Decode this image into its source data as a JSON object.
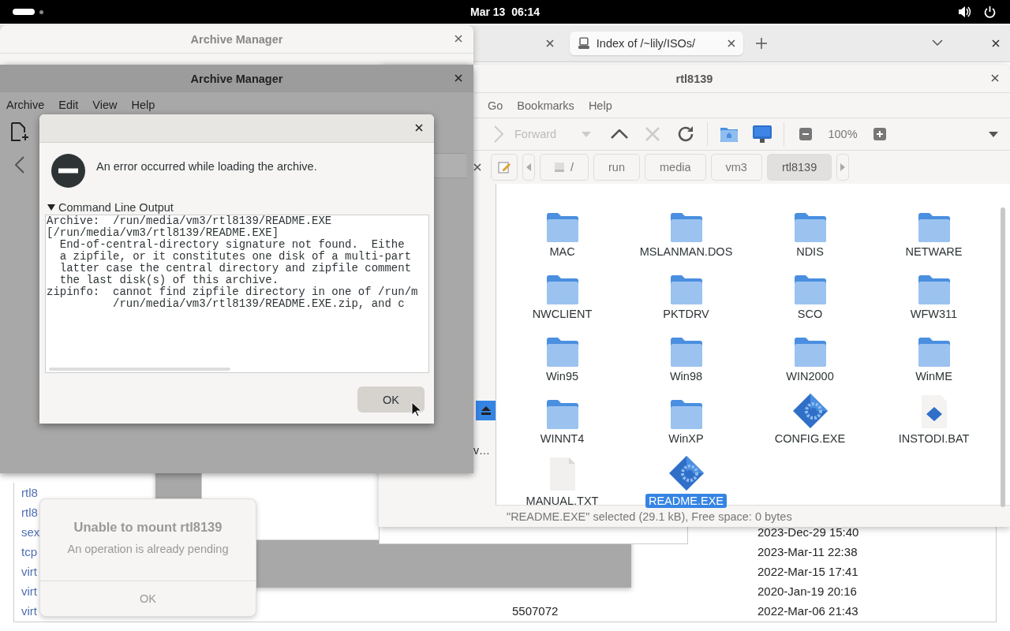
{
  "top_bar": {
    "clock": "Mar 13  06:14"
  },
  "browser": {
    "tabs": [
      {
        "selected": false
      },
      {
        "label": "Index of /~lily/ISOs/",
        "selected": true
      }
    ],
    "listing": [
      {
        "name": "rtl8"
      },
      {
        "name": "rtl8"
      },
      {
        "name": "sex",
        "date": "2023-Dec-29 15:40"
      },
      {
        "name": "tcp",
        "date": "2023-Mar-11 22:38"
      },
      {
        "name": "virt",
        "date": "2022-Mar-15 17:41"
      },
      {
        "name": "virt",
        "date": "2020-Jan-19 20:16"
      },
      {
        "name": "virt",
        "size": "5507072",
        "date": "2022-Mar-06 21:43"
      }
    ]
  },
  "archive_manager_back": {
    "title": "Archive Manager"
  },
  "file_manager": {
    "title": "rtl8139",
    "menu": [
      "Go",
      "Bookmarks",
      "Help"
    ],
    "toolbar": {
      "forward": {
        "label": "Forward",
        "disabled": true
      },
      "zoom": "100%"
    },
    "path": [
      {
        "label": "/",
        "selected": false
      },
      {
        "label": "run",
        "selected": false
      },
      {
        "label": "media",
        "selected": false
      },
      {
        "label": "vm3",
        "selected": false
      },
      {
        "label": "rtl8139",
        "selected": true
      }
    ],
    "sidebar_label": "v…",
    "items": [
      {
        "name": "MAC",
        "kind": "folder",
        "selected": false
      },
      {
        "name": "MSLANMAN.DOS",
        "kind": "folder",
        "selected": false
      },
      {
        "name": "NDIS",
        "kind": "folder",
        "selected": false
      },
      {
        "name": "NETWARE",
        "kind": "folder",
        "selected": false
      },
      {
        "name": "NWCLIENT",
        "kind": "folder",
        "selected": false
      },
      {
        "name": "PKTDRV",
        "kind": "folder",
        "selected": false
      },
      {
        "name": "SCO",
        "kind": "folder",
        "selected": false
      },
      {
        "name": "WFW311",
        "kind": "folder",
        "selected": false
      },
      {
        "name": "Win95",
        "kind": "folder",
        "selected": false
      },
      {
        "name": "Win98",
        "kind": "folder",
        "selected": false
      },
      {
        "name": "WIN2000",
        "kind": "folder",
        "selected": false
      },
      {
        "name": "WinME",
        "kind": "folder",
        "selected": false
      },
      {
        "name": "WINNT4",
        "kind": "folder",
        "selected": false
      },
      {
        "name": "WinXP",
        "kind": "folder",
        "selected": false
      },
      {
        "name": "CONFIG.EXE",
        "kind": "executable",
        "selected": false
      },
      {
        "name": "INSTODI.BAT",
        "kind": "script",
        "selected": false
      },
      {
        "name": "MANUAL.TXT",
        "kind": "text",
        "selected": false
      },
      {
        "name": "README.EXE",
        "kind": "executable",
        "selected": true
      }
    ],
    "status": "\"README.EXE\" selected (29.1 kB), Free space: 0 bytes"
  },
  "archive_manager": {
    "title": "Archive Manager",
    "menu": [
      "Archive",
      "Edit",
      "View",
      "Help"
    ]
  },
  "error_dialog": {
    "message": "An error occurred while loading the archive.",
    "expander": {
      "label": "Command Line Output",
      "expanded": true
    },
    "output": [
      "Archive:  /run/media/vm3/rtl8139/README.EXE",
      "[/run/media/vm3/rtl8139/README.EXE]",
      "  End-of-central-directory signature not found.  Eithe",
      "  a zipfile, or it constitutes one disk of a multi-part",
      "  latter case the central directory and zipfile comment",
      "  the last disk(s) of this archive.",
      "zipinfo:  cannot find zipfile directory in one of /run/m",
      "          /run/media/vm3/rtl8139/README.EXE.zip, and c"
    ],
    "button": "OK"
  },
  "notification": {
    "title": "Unable to mount rtl8139",
    "body": "An operation is already pending",
    "button": "OK"
  }
}
